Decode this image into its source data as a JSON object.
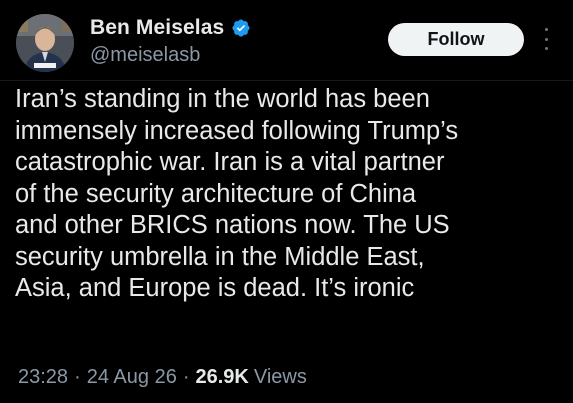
{
  "author": {
    "display_name": "Ben Meiselas",
    "handle": "@meiselasb",
    "verified": true,
    "avatar_icon": "profile-photo"
  },
  "actions": {
    "follow_label": "Follow",
    "more_icon": "more-vertical-icon"
  },
  "tweet": {
    "lines": [
      "Iran’s standing in the world has been",
      "immensely increased following Trump’s",
      "catastrophic war. Iran is a vital partner",
      "of the security architecture of China",
      "and other BRICS nations now. The US",
      "security umbrella in the Middle East,",
      "Asia, and Europe is dead. It’s ironic"
    ]
  },
  "meta": {
    "time": "23:28",
    "separator": "·",
    "date": "24 Aug 26",
    "views_count": "26.9K",
    "views_label": "Views"
  },
  "colors": {
    "background": "#000000",
    "text_primary": "#e7e9ea",
    "text_secondary": "#8b98a5",
    "verified_blue": "#1d9bf0",
    "follow_bg": "#eff3f4"
  }
}
